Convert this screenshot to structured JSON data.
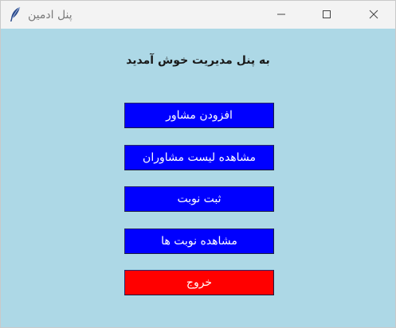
{
  "window": {
    "title": "پنل ادمین",
    "icon": "feather-icon"
  },
  "controls": {
    "minimize": "minimize-icon",
    "maximize": "maximize-icon",
    "close": "close-icon"
  },
  "main": {
    "heading": "به پنل مدیریت خوش آمدید",
    "buttons": [
      {
        "label": "افزودن مشاور",
        "color": "#0000ff"
      },
      {
        "label": "مشاهده لیست مشاوران",
        "color": "#0000ff"
      },
      {
        "label": "ثبت نوبت",
        "color": "#0000ff"
      },
      {
        "label": "مشاهده نوبت ها",
        "color": "#0000ff"
      },
      {
        "label": "خروج",
        "color": "#ff0000"
      }
    ]
  },
  "colors": {
    "background": "#add8e6",
    "titlebar": "#f3f3f3"
  }
}
